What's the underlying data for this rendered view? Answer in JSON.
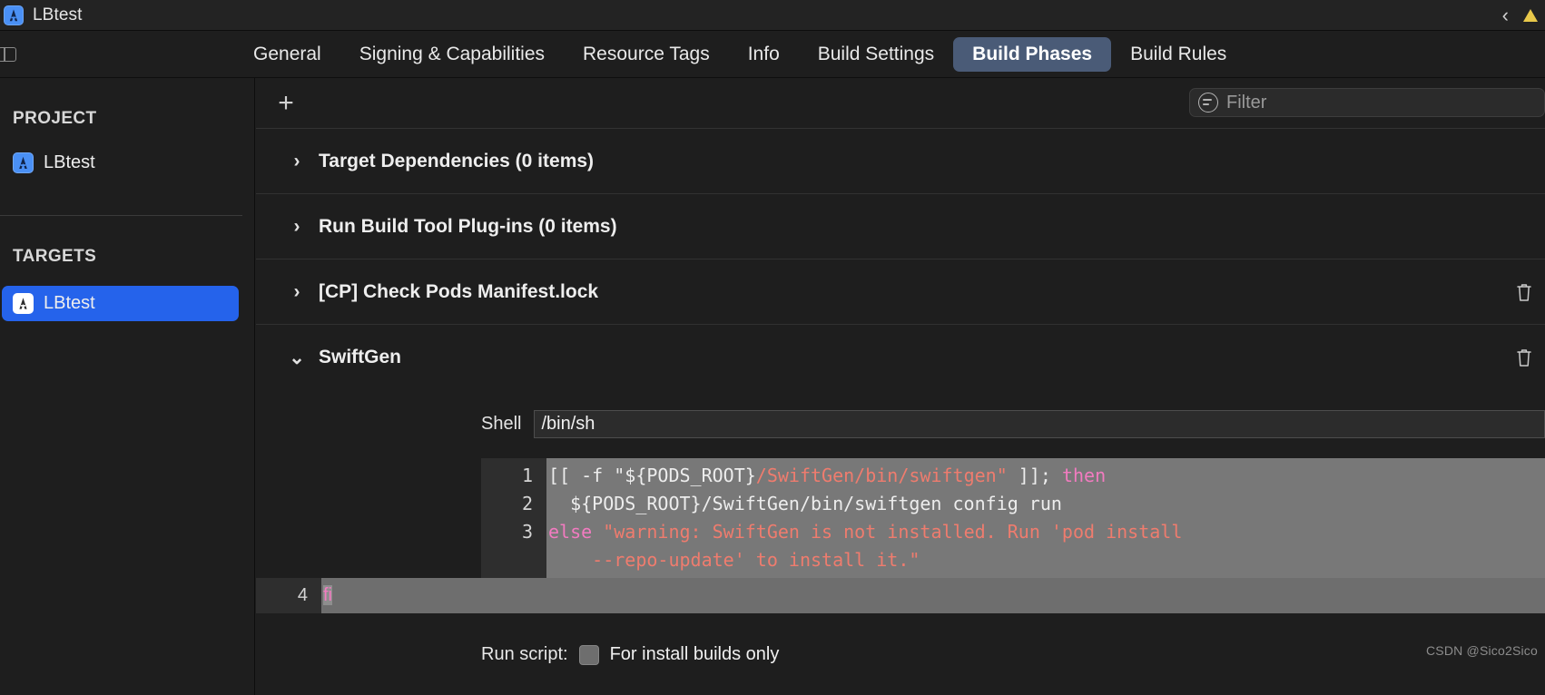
{
  "window": {
    "title": "LBtest",
    "app_icon": "xcode-app-icon",
    "back_chevron_icon": "chevron-left-icon",
    "warning_icon": "warning-triangle-icon"
  },
  "tabbar": {
    "panel_toggle_icon": "navigator-toggle-icon",
    "tabs": [
      {
        "label": "General",
        "selected": false
      },
      {
        "label": "Signing & Capabilities",
        "selected": false
      },
      {
        "label": "Resource Tags",
        "selected": false
      },
      {
        "label": "Info",
        "selected": false
      },
      {
        "label": "Build Settings",
        "selected": false
      },
      {
        "label": "Build Phases",
        "selected": true
      },
      {
        "label": "Build Rules",
        "selected": false
      }
    ],
    "selected_tab_color": "#4a5b77"
  },
  "sidebar": {
    "project_header": "PROJECT",
    "project_items": [
      {
        "label": "LBtest",
        "icon": "xcode-project-icon",
        "selected": false
      }
    ],
    "targets_header": "TARGETS",
    "target_items": [
      {
        "label": "LBtest",
        "icon": "xcode-target-icon",
        "selected": true
      }
    ],
    "selection_color": "#2563eb"
  },
  "toolbar": {
    "add_label": "+",
    "add_icon": "plus-icon",
    "filter_icon": "filter-icon",
    "filter_placeholder": "Filter",
    "filter_value": ""
  },
  "phases": [
    {
      "label": "Target Dependencies (0 items)",
      "expanded": false,
      "chevron": "chevron-right-icon",
      "has_trash": false
    },
    {
      "label": "Run Build Tool Plug-ins (0 items)",
      "expanded": false,
      "chevron": "chevron-right-icon",
      "has_trash": false
    },
    {
      "label": "[CP] Check Pods Manifest.lock",
      "expanded": false,
      "chevron": "chevron-right-icon",
      "has_trash": true
    },
    {
      "label": "SwiftGen",
      "expanded": true,
      "chevron": "chevron-down-icon",
      "has_trash": true
    }
  ],
  "script_phase": {
    "shell_label": "Shell",
    "shell_value": "/bin/sh",
    "line_numbers": [
      "1",
      "2",
      "3",
      "4"
    ],
    "code_lines": [
      {
        "number": "1",
        "segments": [
          {
            "text": "[[ -f ",
            "kind": "plain"
          },
          {
            "text": "\"${PODS_ROOT}",
            "kind": "plain"
          },
          {
            "text": "/SwiftGen/bin/swiftgen\"",
            "kind": "string"
          },
          {
            "text": " ]]; ",
            "kind": "plain"
          },
          {
            "text": "then",
            "kind": "keyword"
          }
        ]
      },
      {
        "number": "2",
        "segments": [
          {
            "text": "  ${PODS_ROOT}/SwiftGen/bin/swiftgen config run",
            "kind": "plain"
          }
        ]
      },
      {
        "number": "3",
        "segments": [
          {
            "text": "else",
            "kind": "keyword"
          },
          {
            "text": " \"warning: SwiftGen is not installed. Run 'pod install",
            "kind": "string"
          }
        ],
        "continuation": [
          {
            "text": "    --repo-update' to install it.\"",
            "kind": "string"
          }
        ]
      },
      {
        "number": "4",
        "segments": [
          {
            "text": "fi",
            "kind": "keyword",
            "selected": true
          }
        ]
      }
    ],
    "run_script_label": "Run script:",
    "install_builds_checkbox_label": "For install builds only",
    "install_builds_checked": false,
    "colors": {
      "editor_background": "#787878",
      "gutter_background": "#2e2e2e",
      "string_color": "#ef7c6e",
      "keyword_color": "#f27bc0",
      "plain_color": "#ededed"
    }
  },
  "watermark": {
    "text": "CSDN @Sico2Sico"
  }
}
